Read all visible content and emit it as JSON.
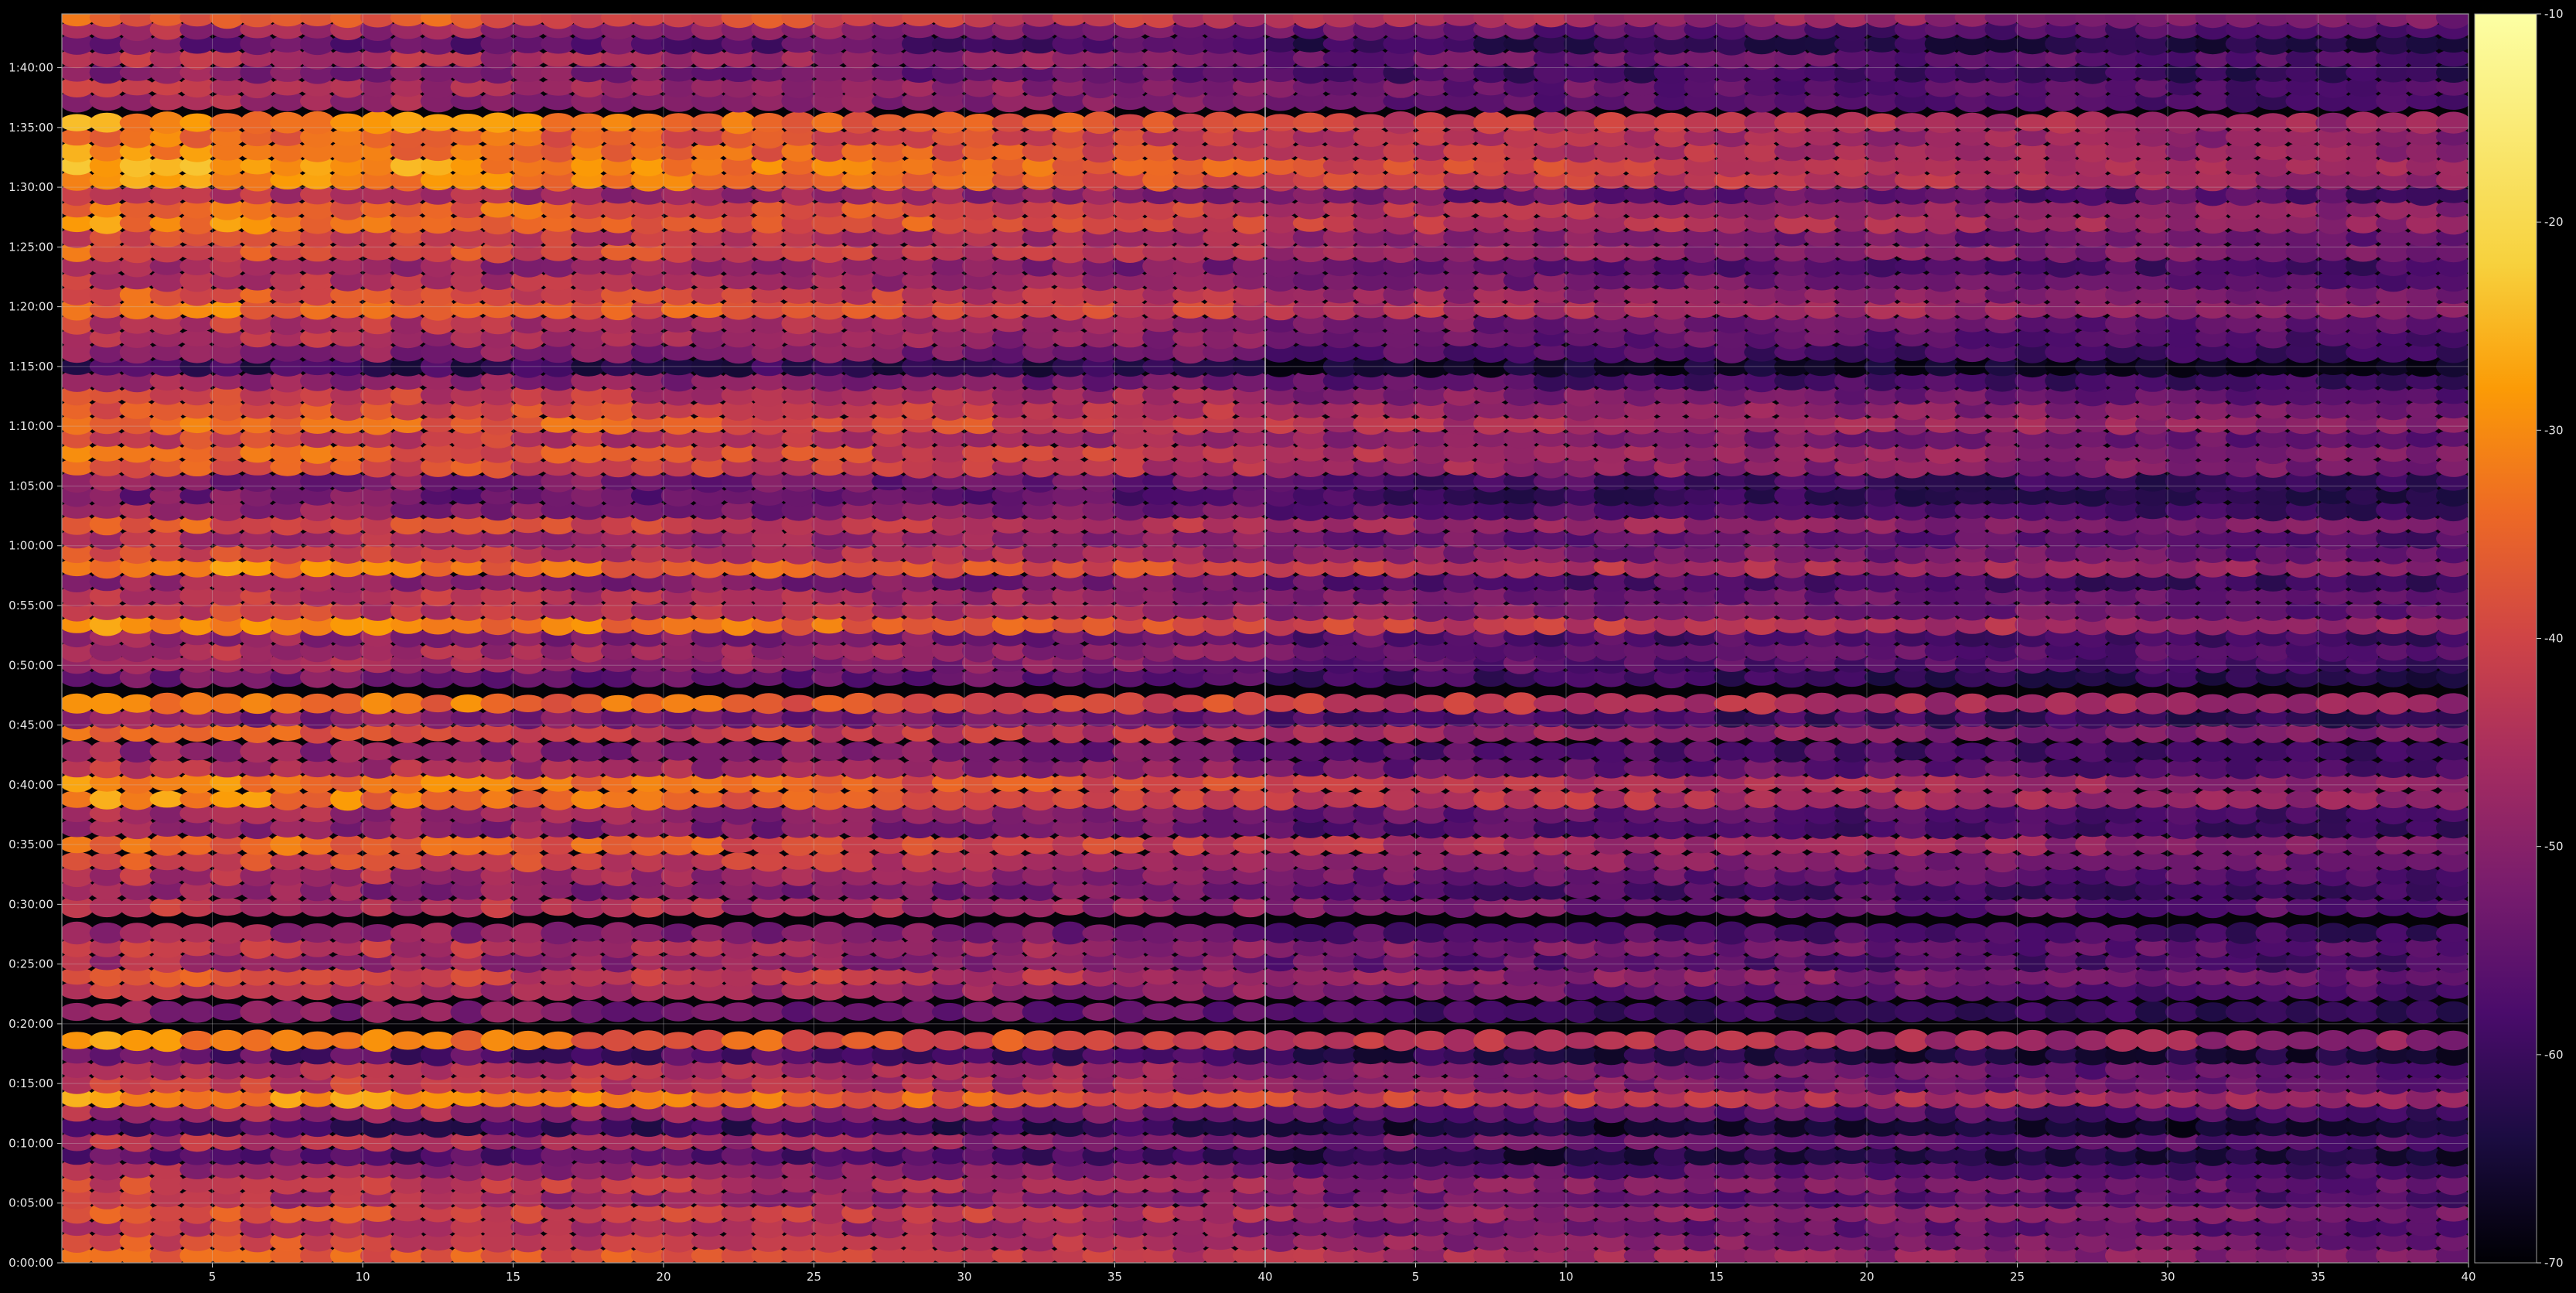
{
  "chart_data": {
    "type": "heatmap",
    "title": "",
    "xlabel": "",
    "ylabel": "",
    "panels": [
      {
        "name": "",
        "x_ticks": [
          "5",
          "10",
          "15",
          "20",
          "25",
          "30",
          "35",
          "40"
        ],
        "xlim": [
          1,
          40
        ],
        "brightness": 1.0
      },
      {
        "name": "",
        "x_ticks": [
          "5",
          "10",
          "15",
          "20",
          "25",
          "30",
          "35",
          "40"
        ],
        "xlim": [
          1,
          40
        ],
        "brightness": 0.55
      }
    ],
    "y_ticks": [
      "0:00:00",
      "0:05:00",
      "0:10:00",
      "0:15:00",
      "0:20:00",
      "0:25:00",
      "0:30:00",
      "0:35:00",
      "0:40:00",
      "0:45:00",
      "0:50:00",
      "0:55:00",
      "1:00:00",
      "1:05:00",
      "1:10:00",
      "1:15:00",
      "1:20:00",
      "1:25:00",
      "1:30:00",
      "1:35:00",
      "1:40:00"
    ],
    "y_range_minutes": [
      0,
      104.5
    ],
    "colorbar": {
      "colormap": "inferno",
      "range": [
        -70,
        -10
      ],
      "ticks": [
        "-10",
        "-20",
        "-30",
        "-40",
        "-50",
        "-60",
        "-70"
      ]
    },
    "band_levels_by_minute": [
      {
        "t": 0.6,
        "v": -34
      },
      {
        "t": 1.8,
        "v": -38
      },
      {
        "t": 3.0,
        "v": -42
      },
      {
        "t": 4.2,
        "v": -36
      },
      {
        "t": 5.4,
        "v": -44
      },
      {
        "t": 6.6,
        "v": -40
      },
      {
        "t": 7.8,
        "v": -46
      },
      {
        "t": 9.0,
        "v": -56
      },
      {
        "t": 10.2,
        "v": -44
      },
      {
        "t": 11.4,
        "v": -58
      },
      {
        "t": 12.6,
        "v": -46
      },
      {
        "t": 13.8,
        "v": -28
      },
      {
        "t": 15.0,
        "v": -40
      },
      {
        "t": 16.2,
        "v": -42
      },
      {
        "t": 17.4,
        "v": -56
      },
      {
        "t": 18.6,
        "v": -30
      },
      {
        "t": 21.0,
        "v": -50
      },
      {
        "t": 22.8,
        "v": -44
      },
      {
        "t": 24.0,
        "v": -38
      },
      {
        "t": 25.2,
        "v": -46
      },
      {
        "t": 26.4,
        "v": -42
      },
      {
        "t": 27.6,
        "v": -48
      },
      {
        "t": 29.8,
        "v": -42
      },
      {
        "t": 31.2,
        "v": -48
      },
      {
        "t": 32.4,
        "v": -44
      },
      {
        "t": 33.6,
        "v": -38
      },
      {
        "t": 35.0,
        "v": -32
      },
      {
        "t": 36.4,
        "v": -48
      },
      {
        "t": 37.6,
        "v": -46
      },
      {
        "t": 38.8,
        "v": -30
      },
      {
        "t": 40.2,
        "v": -30
      },
      {
        "t": 41.4,
        "v": -44
      },
      {
        "t": 42.8,
        "v": -48
      },
      {
        "t": 44.4,
        "v": -36
      },
      {
        "t": 45.6,
        "v": -50
      },
      {
        "t": 46.8,
        "v": -30
      },
      {
        "t": 49.0,
        "v": -52
      },
      {
        "t": 50.2,
        "v": -46
      },
      {
        "t": 51.2,
        "v": -44
      },
      {
        "t": 52.4,
        "v": -48
      },
      {
        "t": 53.4,
        "v": -28
      },
      {
        "t": 54.6,
        "v": -40
      },
      {
        "t": 55.8,
        "v": -42
      },
      {
        "t": 57.0,
        "v": -48
      },
      {
        "t": 58.2,
        "v": -30
      },
      {
        "t": 59.4,
        "v": -40
      },
      {
        "t": 60.6,
        "v": -44
      },
      {
        "t": 61.8,
        "v": -36
      },
      {
        "t": 63.0,
        "v": -48
      },
      {
        "t": 64.2,
        "v": -52
      },
      {
        "t": 65.4,
        "v": -50
      },
      {
        "t": 66.6,
        "v": -36
      },
      {
        "t": 67.8,
        "v": -34
      },
      {
        "t": 69.0,
        "v": -40
      },
      {
        "t": 70.2,
        "v": -32
      },
      {
        "t": 71.4,
        "v": -36
      },
      {
        "t": 72.6,
        "v": -40
      },
      {
        "t": 73.8,
        "v": -48
      },
      {
        "t": 75.0,
        "v": -60
      },
      {
        "t": 76.2,
        "v": -48
      },
      {
        "t": 77.4,
        "v": -44
      },
      {
        "t": 78.6,
        "v": -42
      },
      {
        "t": 79.8,
        "v": -32
      },
      {
        "t": 81.0,
        "v": -36
      },
      {
        "t": 82.2,
        "v": -42
      },
      {
        "t": 83.4,
        "v": -46
      },
      {
        "t": 84.6,
        "v": -36
      },
      {
        "t": 85.8,
        "v": -40
      },
      {
        "t": 87.0,
        "v": -30
      },
      {
        "t": 88.2,
        "v": -32
      },
      {
        "t": 89.4,
        "v": -44
      },
      {
        "t": 90.6,
        "v": -28
      },
      {
        "t": 91.8,
        "v": -26
      },
      {
        "t": 93.0,
        "v": -30
      },
      {
        "t": 94.2,
        "v": -32
      },
      {
        "t": 95.4,
        "v": -28
      },
      {
        "t": 97.2,
        "v": -46
      },
      {
        "t": 98.4,
        "v": -44
      },
      {
        "t": 99.6,
        "v": -50
      },
      {
        "t": 100.8,
        "v": -44
      },
      {
        "t": 102.0,
        "v": -54
      },
      {
        "t": 103.2,
        "v": -46
      },
      {
        "t": 104.2,
        "v": -34
      }
    ]
  }
}
